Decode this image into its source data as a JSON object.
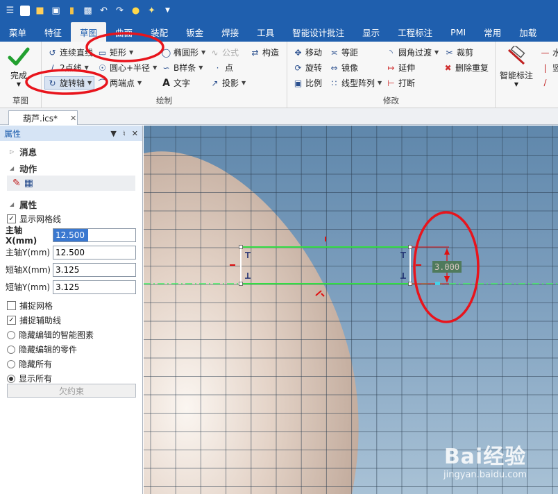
{
  "menu": {
    "items": [
      "菜单",
      "特征",
      "草图",
      "曲面",
      "装配",
      "钣金",
      "焊接",
      "工具",
      "智能设计批注",
      "显示",
      "工程标注",
      "PMI",
      "常用",
      "加载"
    ],
    "active_index": 2
  },
  "ribbon": {
    "done_label": "完成",
    "draw_group_label": "绘制",
    "modify_group_label": "修改",
    "sketch_group_label": "草图",
    "continuous_line": "连续直线",
    "rectangle": "矩形",
    "ellipse": "椭圆形",
    "formula": "公式",
    "construct": "构造",
    "two_point_line": "2点线",
    "center_radius": "圆心+半径",
    "bspline": "B样条",
    "point": "点",
    "rotation_axis": "旋转轴",
    "two_points": "两端点",
    "text": "文字",
    "projection": "投影",
    "move": "移动",
    "equidistant": "等距",
    "fillet_transition": "圆角过渡",
    "trim": "裁剪",
    "rotate": "旋转",
    "mirror": "镜像",
    "extend": "延伸",
    "delete_duplicate": "删除重复",
    "scale": "比例",
    "linear_array": "线型阵列",
    "break": "打断",
    "smart_dim": "智能标注",
    "horizontal": "水",
    "vertical": "竖"
  },
  "doc_tab": {
    "title": "葫芦.ics*"
  },
  "panel": {
    "title": "属性",
    "section_messages": "消息",
    "section_actions": "动作",
    "section_properties": "属性",
    "show_grid": "显示网格线",
    "major_x_label": "主轴X(mm)",
    "major_x_value": "12.500",
    "major_y_label": "主轴Y(mm)",
    "major_y_value": "12.500",
    "minor_x_label": "短轴X(mm)",
    "minor_x_value": "3.125",
    "minor_y_label": "短轴Y(mm)",
    "minor_y_value": "3.125",
    "snap_grid": "捕捉网格",
    "snap_aux": "捕捉辅助线",
    "hide_smart": "隐藏编辑的智能图素",
    "hide_parts": "隐藏编辑的零件",
    "hide_all": "隐藏所有",
    "show_all": "显示所有",
    "under_constrained": "欠约束"
  },
  "viewport": {
    "dimension_value": "3.000",
    "watermark_main": "Bai经验",
    "watermark_sub": "jingyan.baidu.com"
  },
  "colors": {
    "title_blue": "#1f5fae",
    "sketch_green": "#33dd44",
    "annotation_red": "#e01010",
    "highlight_red": "#e8141c"
  }
}
